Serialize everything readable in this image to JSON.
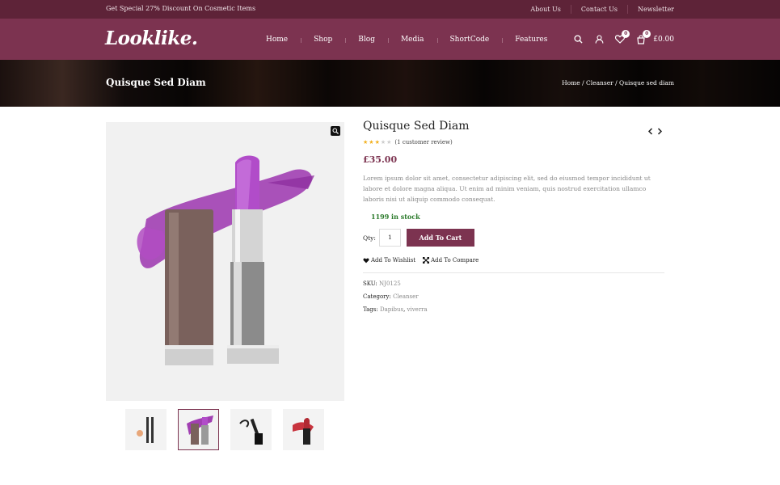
{
  "topbar": {
    "promo": "Get Special 27% Discount On Cosmetic Items",
    "links": [
      "About Us",
      "Contact Us",
      "Newsletter"
    ]
  },
  "header": {
    "logo": "Looklike.",
    "nav": [
      "Home",
      "Shop",
      "Blog",
      "Media",
      "ShortCode",
      "Features"
    ],
    "wishlist_count": "0",
    "cart_count": "0",
    "cart_total": "£0.00",
    "icons": [
      "search-icon",
      "user-icon",
      "heart-icon",
      "cart-icon"
    ]
  },
  "banner": {
    "title": "Quisque Sed Diam",
    "breadcrumb": "Home / Cleanser / Quisque sed diam"
  },
  "product": {
    "title": "Quisque Sed Diam",
    "rating": 3,
    "rating_max": 5,
    "review_text": "(1 customer review)",
    "price": "£35.00",
    "description": "Lorem ipsum dolor sit amet, consectetur adipiscing elit, sed do eiusmod tempor incididunt ut labore et dolore magna aliqua. Ut enim ad minim veniam, quis nostrud exercitation ullamco laboris nisi ut aliquip commodo consequat.",
    "stock": "1199 in stock",
    "qty_label": "Qty:",
    "qty": "1",
    "add_to_cart": "Add To Cart",
    "wishlist": "Add To Wishlist",
    "compare": "Add To Compare",
    "sku_label": "SKU:",
    "sku": "NJ0125",
    "category_label": "Category:",
    "category": "Cleanser",
    "tags_label": "Tags:",
    "tags": [
      "Dapibus",
      "viverra"
    ],
    "tag_sep": ","
  },
  "colors": {
    "brand": "#7c3350",
    "topbar": "#5e2338",
    "stock": "#2a7a2a",
    "star": "#f2b01e"
  }
}
